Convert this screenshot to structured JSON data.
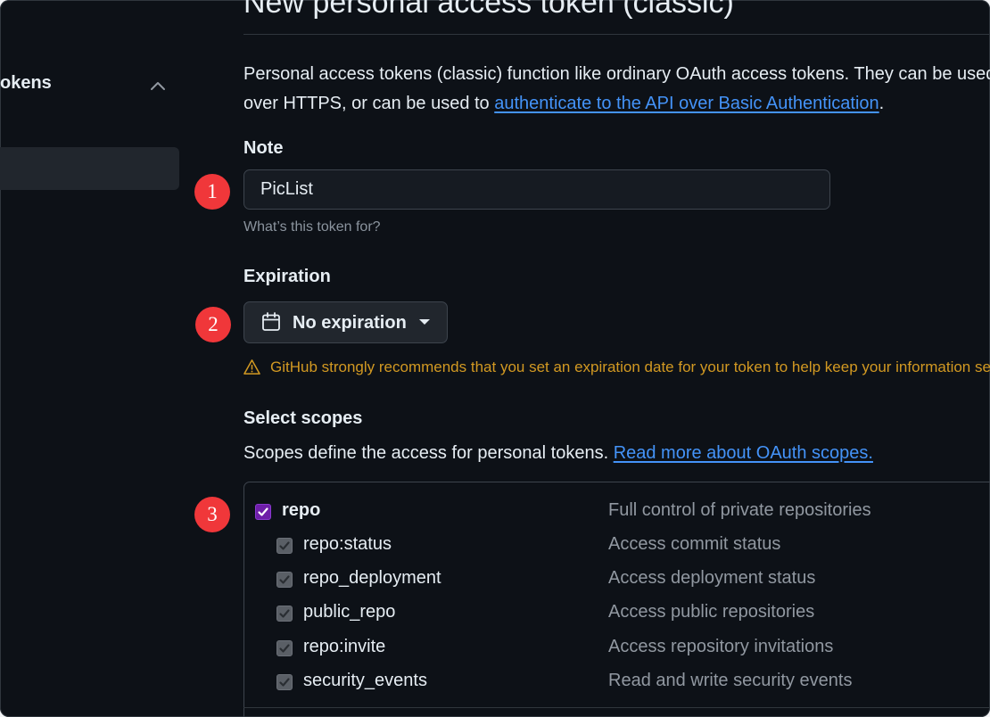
{
  "sidebar": {
    "section_label": "okens",
    "collapse_icon": "chevron-up-icon"
  },
  "page": {
    "title": "New personal access token (classic)",
    "intro_text_1": "Personal access tokens (classic) function like ordinary OAuth access tokens. They can be used",
    "intro_text_2": "over HTTPS, or can be used to ",
    "intro_link": "authenticate to the API over Basic Authentication",
    "intro_text_3": "."
  },
  "note": {
    "label": "Note",
    "value": "PicList",
    "hint": "What’s this token for?"
  },
  "expiration": {
    "label": "Expiration",
    "selected": "No expiration",
    "icon": "calendar-icon",
    "warning": "GitHub strongly recommends that you set an expiration date for your token to help keep your information secure."
  },
  "scopes": {
    "label": "Select scopes",
    "description": "Scopes define the access for personal tokens. ",
    "link": "Read more about OAuth scopes.",
    "items": [
      {
        "name": "repo",
        "description": "Full control of private repositories",
        "checked": true
      },
      {
        "name": "repo:status",
        "description": "Access commit status",
        "checked": true
      },
      {
        "name": "repo_deployment",
        "description": "Access deployment status",
        "checked": true
      },
      {
        "name": "public_repo",
        "description": "Access public repositories",
        "checked": true
      },
      {
        "name": "repo:invite",
        "description": "Access repository invitations",
        "checked": true
      },
      {
        "name": "security_events",
        "description": "Read and write security events",
        "checked": true
      }
    ]
  },
  "badges": {
    "step1": "1",
    "step2": "2",
    "step3": "3"
  },
  "colors": {
    "background": "#0d1117",
    "text": "#e6edf3",
    "muted": "#8b949e",
    "link": "#4493f8",
    "warning": "#d29922",
    "badge": "#f0373a",
    "checkbox_checked": "#6e1ea8"
  }
}
